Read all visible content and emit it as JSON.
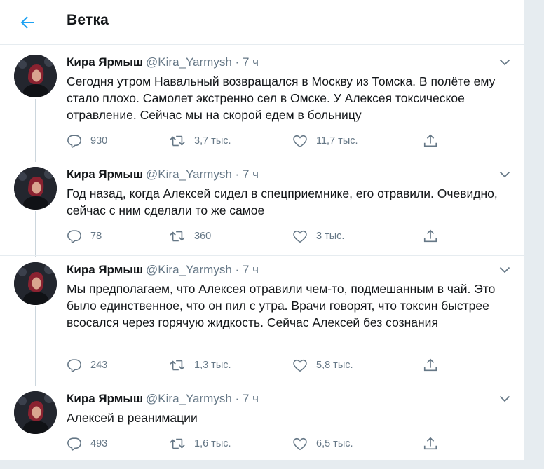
{
  "header": {
    "title": "Ветка"
  },
  "colors": {
    "accent": "#1da1f2",
    "muted": "#657786",
    "thread_line": "#ccd6dd"
  },
  "icons": {
    "back": "arrow-left-icon",
    "caret": "chevron-down-icon",
    "reply": "reply-icon",
    "retweet": "retweet-icon",
    "like": "heart-icon",
    "share": "share-icon"
  },
  "tweets": [
    {
      "name": "Кира Ярмыш",
      "handle": "@Kira_Yarmysh",
      "dot": "·",
      "time": "7 ч",
      "text": "Сегодня утром Навальный возвращался в Москву из Томска. В полёте ему стало плохо. Самолет экстренно сел в Омске. У Алексея токсическое отравление. Сейчас мы на скорой едем в больницу",
      "replies": "930",
      "retweets": "3,7 тыс.",
      "likes": "11,7 тыс."
    },
    {
      "name": "Кира Ярмыш",
      "handle": "@Kira_Yarmysh",
      "dot": "·",
      "time": "7 ч",
      "text": "Год назад, когда Алексей сидел в спецприемнике, его отравили. Очевидно, сейчас с ним сделали то же самое",
      "replies": "78",
      "retweets": "360",
      "likes": "3 тыс."
    },
    {
      "name": "Кира Ярмыш",
      "handle": "@Kira_Yarmysh",
      "dot": "·",
      "time": "7 ч",
      "text": "Мы предполагаем, что Алексея отравили чем-то, подмешанным в чай. Это было единственное, что он пил с утра. Врачи говорят, что токсин быстрее всосался через горячую жидкость. Сейчас Алексей без сознания",
      "replies": "243",
      "retweets": "1,3 тыс.",
      "likes": "5,8 тыс."
    },
    {
      "name": "Кира Ярмыш",
      "handle": "@Kira_Yarmysh",
      "dot": "·",
      "time": "7 ч",
      "text": "Алексей в реанимации",
      "replies": "493",
      "retweets": "1,6 тыс.",
      "likes": "6,5 тыс."
    }
  ]
}
